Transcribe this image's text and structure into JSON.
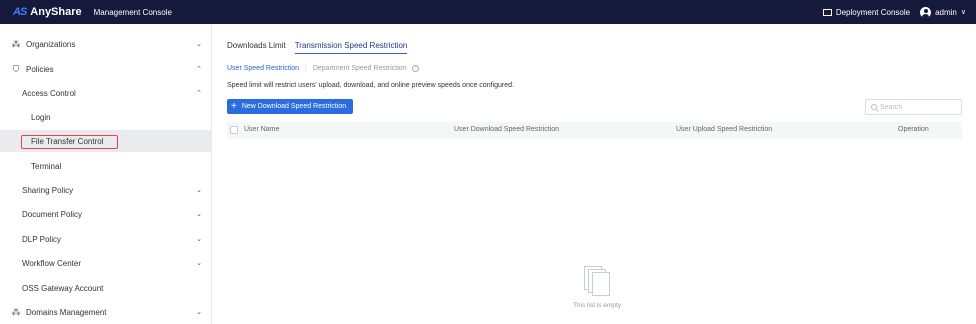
{
  "header": {
    "logo_mark": "AS",
    "logo_text": "AnyShare",
    "console_title": "Management Console",
    "deployment_console": "Deployment Console",
    "user": "admin"
  },
  "sidebar": {
    "items": [
      {
        "label": "Organizations",
        "icon": "organization-icon",
        "caret": "⌄"
      },
      {
        "label": "Policies",
        "icon": "shield-icon",
        "caret": "⌃"
      },
      {
        "label": "Access Control",
        "caret": "⌃"
      },
      {
        "label": "Login"
      },
      {
        "label": "File Transfer Control",
        "selected": true
      },
      {
        "label": "Terminal"
      },
      {
        "label": "Sharing Policy",
        "caret": "⌄"
      },
      {
        "label": "Document Policy",
        "caret": "⌄"
      },
      {
        "label": "DLP Policy",
        "caret": "⌄"
      },
      {
        "label": "Workflow Center",
        "caret": "⌄"
      },
      {
        "label": "OSS Gateway Account"
      },
      {
        "label": "Domains Management",
        "icon": "domain-icon",
        "caret": "⌄"
      }
    ]
  },
  "main": {
    "tabs": [
      {
        "label": "Downloads Limit",
        "active": false
      },
      {
        "label": "Transmission Speed Restriction",
        "active": true
      }
    ],
    "subtabs": [
      {
        "label": "User Speed Restriction",
        "active": true
      },
      {
        "label": "Department Speed Restriction",
        "active": false
      }
    ],
    "description": "Speed limit will restrict users' upload, download, and online preview speeds once configured.",
    "new_button": "New Download Speed Restriction",
    "search_placeholder": "Search",
    "table": {
      "columns": [
        "User Name",
        "User Download Speed Restriction",
        "User Upload Speed Restriction",
        "Operation"
      ]
    },
    "empty_text": "This list is empty"
  },
  "colors": {
    "topbar": "#15193c",
    "accent": "#2b6de0",
    "highlight": "#e8424a",
    "selected_bg": "#e9ebef"
  }
}
